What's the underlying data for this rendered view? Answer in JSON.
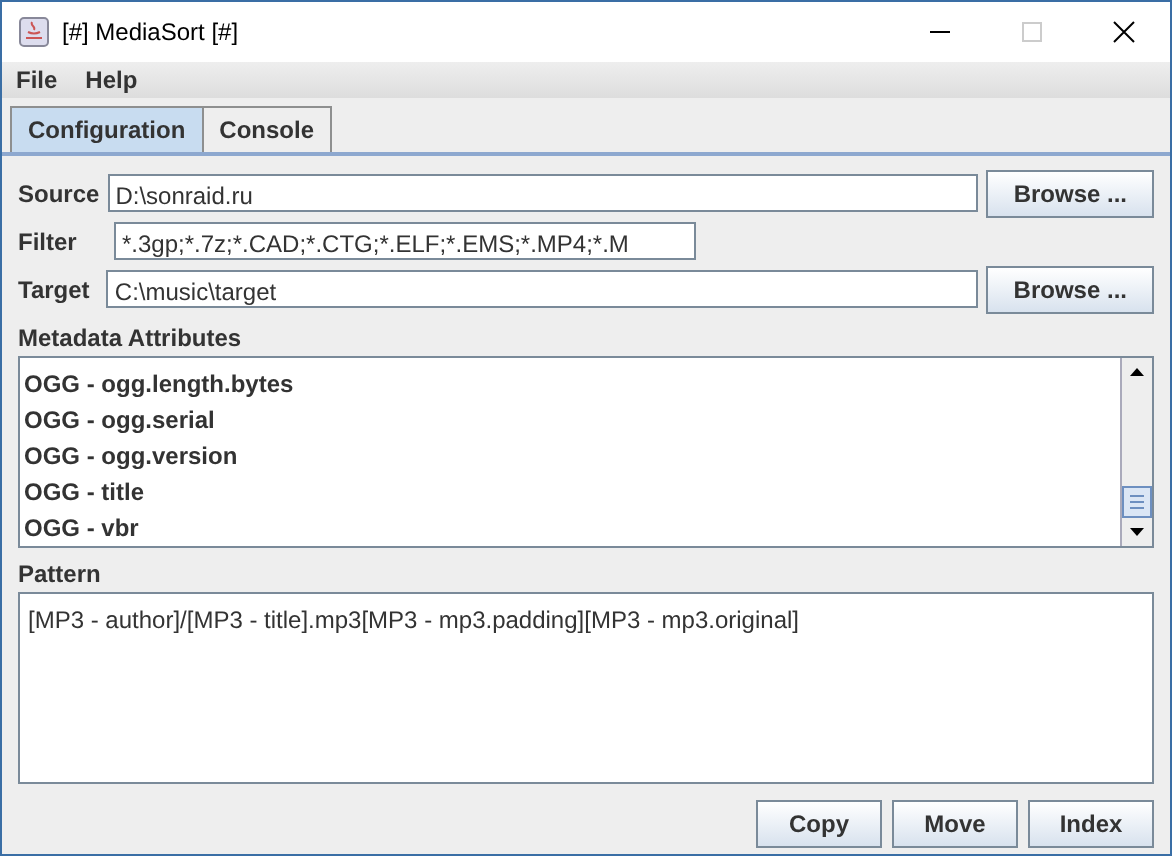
{
  "window": {
    "title": "[#] MediaSort [#]"
  },
  "menu": [
    "File",
    "Help"
  ],
  "tabs": [
    {
      "label": "Configuration",
      "selected": true
    },
    {
      "label": "Console",
      "selected": false
    }
  ],
  "fields": [
    {
      "label": "Source",
      "value": "D:\\sonraid.ru",
      "button": "Browse ..."
    },
    {
      "label": "Filter",
      "value": "*.3gp;*.7z;*.CAD;*.CTG;*.ELF;*.EMS;*.MP4;*.M"
    },
    {
      "label": "Target",
      "value": "C:\\music\\target",
      "button": "Browse ..."
    }
  ],
  "metadata": {
    "title": "Metadata Attributes",
    "items": [
      "OGG - ogg.length.bytes",
      "OGG - ogg.serial",
      "OGG - ogg.version",
      "OGG - title",
      "OGG - vbr"
    ]
  },
  "pattern": {
    "title": "Pattern",
    "value": "[MP3 - author]/[MP3 - title].mp3[MP3 - mp3.padding][MP3 - mp3.original]"
  },
  "buttons": [
    "Copy",
    "Move",
    "Index"
  ]
}
